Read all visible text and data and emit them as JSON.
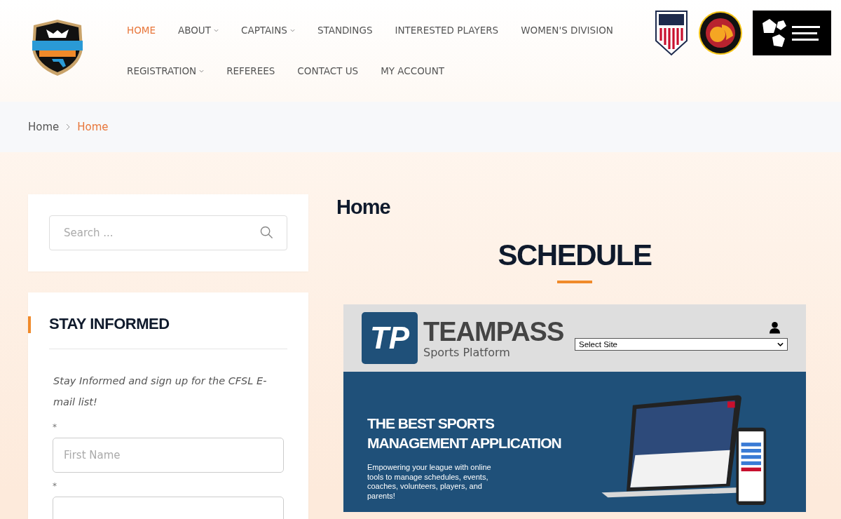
{
  "header": {
    "nav_rows": [
      [
        {
          "label": "HOME",
          "selected": true,
          "dropdown": false
        },
        {
          "label": "ABOUT",
          "selected": false,
          "dropdown": true
        },
        {
          "label": "CAPTAINS",
          "selected": false,
          "dropdown": true
        },
        {
          "label": "STANDINGS",
          "selected": false,
          "dropdown": false
        },
        {
          "label": "INTERESTED PLAYERS",
          "selected": false,
          "dropdown": false
        },
        {
          "label": "WOMEN'S DIVISION",
          "selected": false,
          "dropdown": false
        }
      ],
      [
        {
          "label": "REGISTRATION",
          "selected": false,
          "dropdown": true
        },
        {
          "label": "REFEREES",
          "selected": false,
          "dropdown": false
        },
        {
          "label": "CONTACT US",
          "selected": false,
          "dropdown": false
        },
        {
          "label": "MY ACCOUNT",
          "selected": false,
          "dropdown": false
        }
      ]
    ]
  },
  "breadcrumb": [
    {
      "label": "Home",
      "current": false
    },
    {
      "label": "Home",
      "current": true
    }
  ],
  "sidebar": {
    "search": {
      "placeholder": "Search ..."
    },
    "newsletter": {
      "title": "STAY INFORMED",
      "intro": "Stay Informed and sign up for the CFSL E-mail list!",
      "fields": [
        {
          "required_mark": "*",
          "placeholder": "First Name"
        },
        {
          "required_mark": "*"
        }
      ]
    }
  },
  "content": {
    "page_title": "Home",
    "heading": "SCHEDULE",
    "embed": {
      "logo_mark": "TP",
      "brand": "TEAMPASS",
      "tagline": "Sports Platform",
      "site_select": "Select Site",
      "hero_title": "THE BEST SPORTS MANAGEMENT APPLICATION",
      "hero_text": "Empowering your league with online tools to manage schedules, events, coaches, volunteers, players, and parents!"
    }
  }
}
